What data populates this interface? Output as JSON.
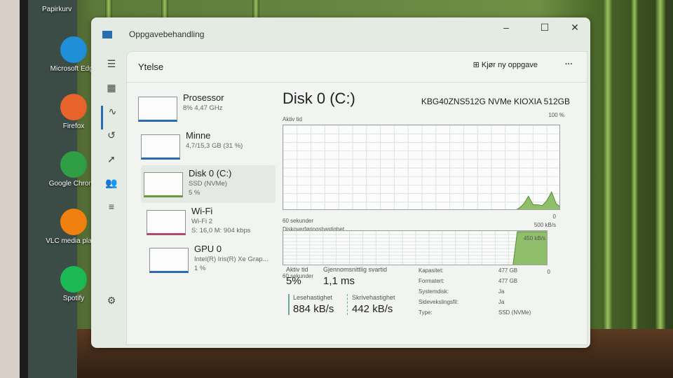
{
  "desktop": {
    "recycle_label": "Papirkurv",
    "icons": [
      {
        "label": "Microsoft Edge",
        "name": "edge",
        "color": "#1f8fd8"
      },
      {
        "label": "Firefox",
        "name": "firefox",
        "color": "#e8632b"
      },
      {
        "label": "Google Chrome",
        "name": "chrome",
        "color": "#2f9e44"
      },
      {
        "label": "VLC media player",
        "name": "vlc",
        "color": "#f08010"
      },
      {
        "label": "Spotify",
        "name": "spotify",
        "color": "#1db954"
      }
    ]
  },
  "window": {
    "title": "Oppgavebehandling",
    "minimize": "–",
    "maximize": "☐",
    "close": "✕"
  },
  "rail": [
    "☰",
    "▦",
    "∿",
    "↺",
    "➚",
    "👥",
    "≡",
    "⚙"
  ],
  "header": {
    "title": "Ytelse",
    "run_task": "Kjør ny oppgave",
    "more": "···"
  },
  "list": [
    {
      "title": "Prosessor",
      "sub1": "8% 4,47 GHz",
      "sub2": ""
    },
    {
      "title": "Minne",
      "sub1": "4,7/15,3 GB (31 %)",
      "sub2": ""
    },
    {
      "title": "Disk 0 (C:)",
      "sub1": "SSD (NVMe)",
      "sub2": "5 %"
    },
    {
      "title": "Wi-Fi",
      "sub1": "Wi-Fi 2",
      "sub2": "S: 16,0 M: 904 kbps"
    },
    {
      "title": "GPU 0",
      "sub1": "Intel(R) Iris(R) Xe Grap...",
      "sub2": "1 %"
    }
  ],
  "main": {
    "title": "Disk 0 (C:)",
    "model": "KBG40ZNS512G NVMe KIOXIA 512GB"
  },
  "chart_data": [
    {
      "type": "area",
      "title": "Aktiv tid",
      "ymax_label": "100 %",
      "ymin_label": "0",
      "xlabel": "60 sekunder",
      "ylim": [
        0,
        100
      ],
      "color": "#8fbf6a",
      "values": [
        0,
        0,
        0,
        0,
        0,
        0,
        0,
        0,
        0,
        0,
        0,
        0,
        0,
        0,
        0,
        0,
        0,
        0,
        0,
        0,
        0,
        0,
        0,
        0,
        0,
        0,
        0,
        0,
        0,
        0,
        0,
        0,
        0,
        0,
        0,
        0,
        0,
        0,
        0,
        0,
        0,
        0,
        0,
        0,
        0,
        0,
        0,
        0,
        0,
        0,
        0,
        3,
        8,
        17,
        7,
        7,
        6,
        12,
        22,
        8,
        4
      ]
    },
    {
      "type": "area",
      "title": "Diskoverføringshastighet",
      "ymax_label": "500 kB/s",
      "ymin_label": "0",
      "xlabel": "60 sekunder",
      "annotation": "450 kB/s",
      "ylim": [
        0,
        500
      ],
      "color": "#8fbf6a",
      "values": [
        0,
        0,
        0,
        0,
        0,
        0,
        0,
        0,
        0,
        0,
        0,
        0,
        0,
        0,
        0,
        0,
        0,
        0,
        0,
        0,
        0,
        0,
        0,
        0,
        0,
        0,
        0,
        0,
        0,
        0,
        0,
        0,
        0,
        0,
        0,
        0,
        0,
        0,
        0,
        0,
        0,
        0,
        0,
        0,
        0,
        0,
        0,
        0,
        0,
        0,
        0,
        0,
        0,
        490,
        490,
        490,
        490,
        490,
        490,
        490,
        490
      ]
    }
  ],
  "stats": {
    "active_label": "Aktiv tid",
    "active": "5%",
    "resp_label": "Gjennomsnittlig svartid",
    "resp": "1,1 ms",
    "read_label": "Lesehastighet",
    "read": "884 kB/s",
    "write_label": "Skrivehastighet",
    "write": "442 kB/s"
  },
  "props": [
    {
      "k": "Kapasitet:",
      "v": "477 GB"
    },
    {
      "k": "Formatert:",
      "v": "477 GB"
    },
    {
      "k": "Systemdisk:",
      "v": "Ja"
    },
    {
      "k": "Sidevekslingsfil:",
      "v": "Ja"
    },
    {
      "k": "Type:",
      "v": "SSD (NVMe)"
    }
  ]
}
